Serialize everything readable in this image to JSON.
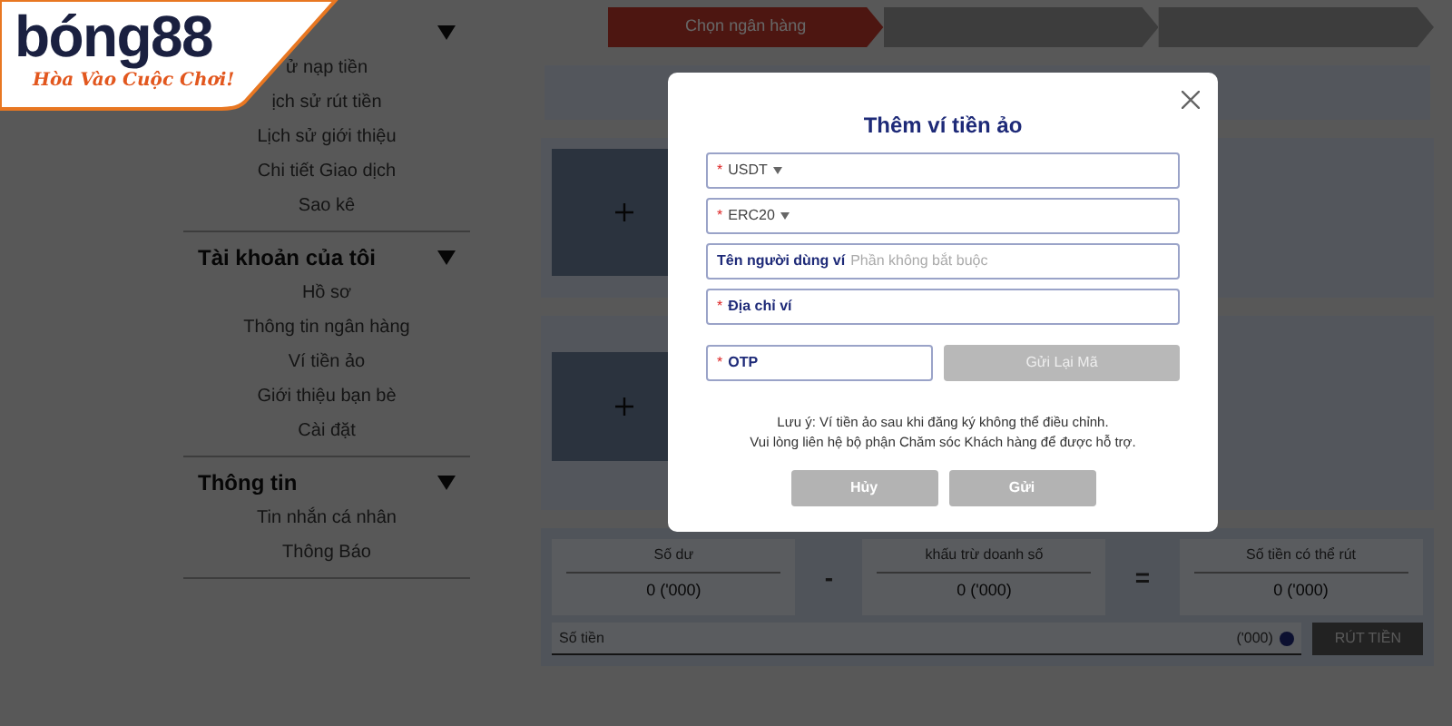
{
  "logo": {
    "name": "bóng88",
    "tagline": "Hòa Vào Cuộc Chơi!"
  },
  "steps": [
    {
      "label": "Chọn ngân hàng",
      "selected": true
    },
    {
      "selected": false
    },
    {
      "selected": false
    }
  ],
  "sidebar": [
    {
      "expanded": true,
      "items": [
        "ử nạp tiền",
        "ịch sử rút tiền",
        "Lịch sử giới thiệu",
        "Chi tiết Giao dịch",
        "Sao kê"
      ]
    },
    {
      "title": "Tài khoản của tôi",
      "expanded": true,
      "items": [
        "Hồ sơ",
        "Thông tin ngân hàng",
        "Ví tiền ảo",
        "Giới thiệu bạn bè",
        "Cài đặt"
      ]
    },
    {
      "title": "Thông tin",
      "expanded": true,
      "items": [
        "Tin nhắn cá nhân",
        "Thông Báo"
      ]
    }
  ],
  "summary": {
    "cells": [
      {
        "label": "Số dư",
        "value": "0 ('000)"
      },
      {
        "label": "khấu trừ doanh số",
        "value": "0 ('000)"
      },
      {
        "label": "Số tiền có thể rút",
        "value": "0 ('000)"
      }
    ],
    "operators": [
      "-",
      "="
    ],
    "amount_placeholder": "Số tiền",
    "unit": "('000)",
    "button": "RÚT TIỀN"
  },
  "dialog": {
    "title": "Thêm ví tiền ảo",
    "fields": [
      {
        "kind": "select",
        "mark": "*",
        "value": "USDT"
      },
      {
        "kind": "select",
        "mark": "*",
        "value": "ERC20"
      },
      {
        "kind": "text",
        "label": "Tên người dùng ví",
        "placeholder": "Phần không bắt buộc"
      },
      {
        "kind": "text",
        "mark": "*",
        "label": "Địa chỉ ví"
      }
    ],
    "otp": {
      "mark": "*",
      "label": "OTP",
      "button": "Gửi Lại Mã",
      "disabled": true
    },
    "note": [
      "Lưu ý: Ví tiền ảo sau khi đăng ký không thể điều chỉnh.",
      "Vui lòng liên hệ bộ phận Chăm sóc Khách hàng để được hỗ trợ."
    ],
    "buttons": [
      "Hủy",
      "Gửi"
    ]
  }
}
